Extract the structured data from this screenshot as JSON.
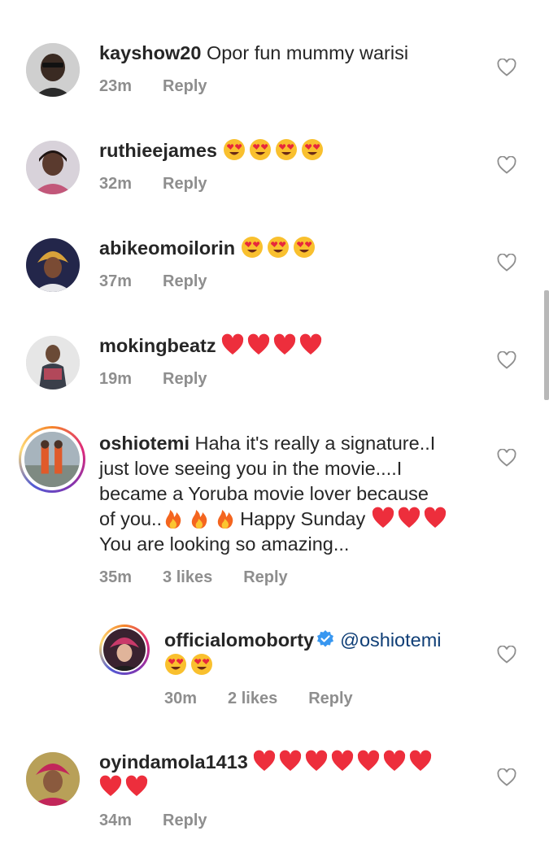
{
  "comments": [
    {
      "username": "kayshow20",
      "text": "Opor fun mummy warisi",
      "time": "23m",
      "reply": "Reply",
      "emojis": [],
      "avatar_colors": [
        "#cfcfcf",
        "#3a3a3a"
      ]
    },
    {
      "username": "ruthieejames",
      "text": "",
      "time": "32m",
      "reply": "Reply",
      "emojis": [
        "heart-eyes",
        "heart-eyes",
        "heart-eyes",
        "heart-eyes"
      ],
      "avatar_colors": [
        "#d8d2da",
        "#c2577a"
      ]
    },
    {
      "username": "abikeomoilorin",
      "text": "",
      "time": "37m",
      "reply": "Reply",
      "emojis": [
        "heart-eyes",
        "heart-eyes",
        "heart-eyes"
      ],
      "avatar_colors": [
        "#23264a",
        "#d8a23a"
      ]
    },
    {
      "username": "mokingbeatz",
      "text": "",
      "time": "19m",
      "reply": "Reply",
      "emojis": [
        "red-heart",
        "red-heart",
        "red-heart",
        "red-heart"
      ],
      "avatar_colors": [
        "#e6e6e6",
        "#6a4a36"
      ]
    },
    {
      "username": "oshiotemi",
      "text_lines": [
        "Haha it's really a signature..I",
        "just love seeing you in the movie....I",
        "became a Yoruba movie lover because",
        "of you..",
        "You are looking so amazing..."
      ],
      "inline_text": "Happy Sunday",
      "time": "35m",
      "likes": "3 likes",
      "reply": "Reply",
      "avatar_colors": [
        "#a7b4bd",
        "#e05a2a"
      ]
    },
    {
      "username": "officialomoborty",
      "mention": "@oshiotemi",
      "time": "30m",
      "likes": "2 likes",
      "reply": "Reply",
      "emojis": [
        "heart-eyes",
        "heart-eyes"
      ],
      "avatar_colors": [
        "#3a2230",
        "#e0b49a"
      ]
    },
    {
      "username": "oyindamola1413",
      "text": "",
      "time": "34m",
      "reply": "Reply",
      "emojis_line1": 7,
      "emojis_line2": 2,
      "avatar_colors": [
        "#b8a058",
        "#c2265a"
      ]
    }
  ],
  "colors": {
    "text": "#262626",
    "meta": "#8e8e8e",
    "mention": "#0f3e76",
    "heart": "#ed2e3c",
    "verified": "#3897f0"
  },
  "icons": {
    "like": "heart-outline-icon",
    "verified": "verified-badge-icon",
    "emoji_heart_eyes": "heart-eyes-emoji",
    "emoji_red_heart": "red-heart-emoji",
    "emoji_fire": "fire-emoji"
  }
}
